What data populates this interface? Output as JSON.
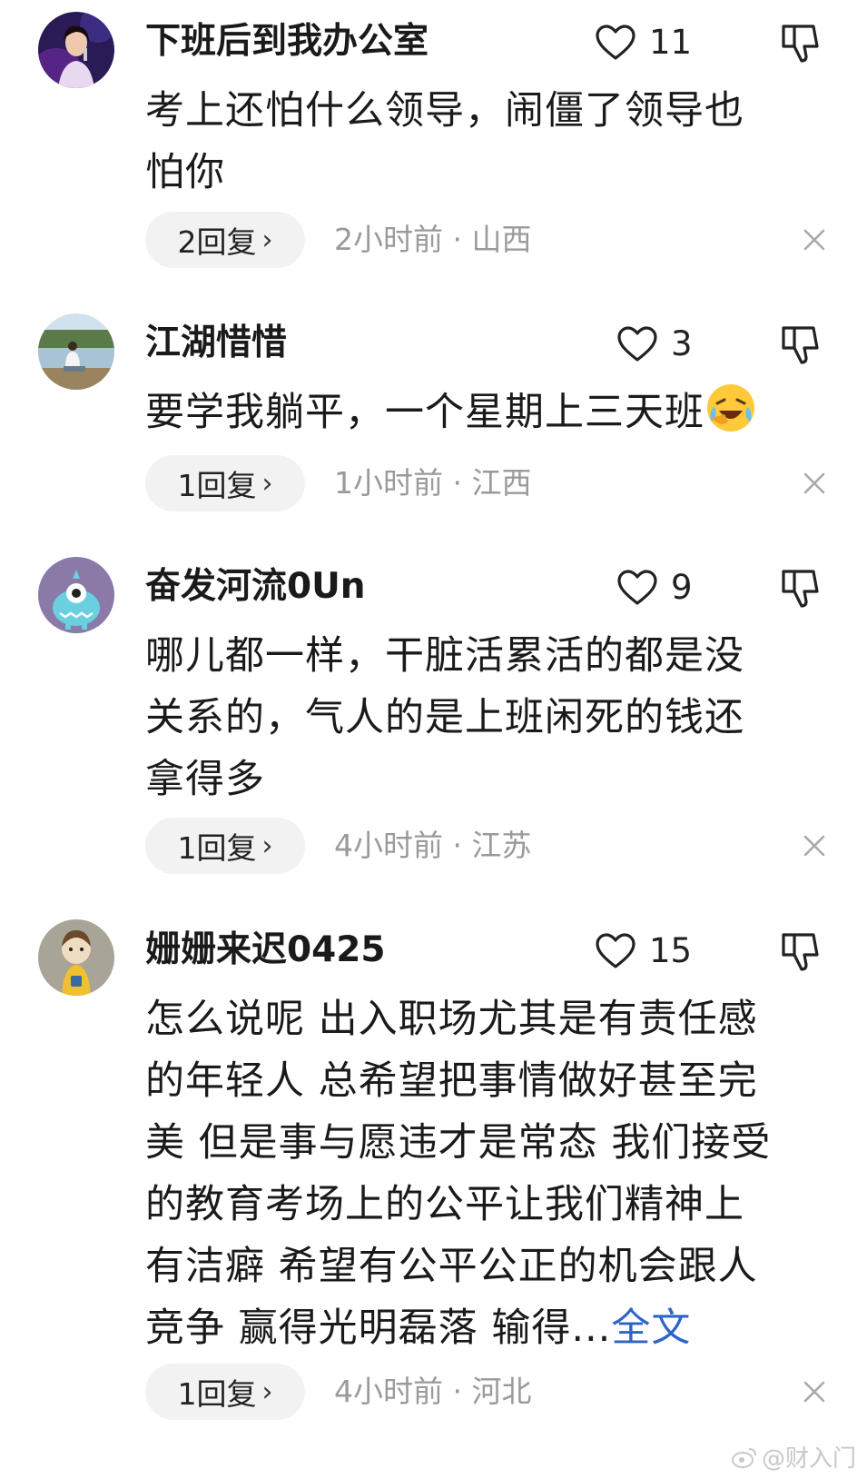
{
  "comments": [
    {
      "username": "下班后到我办公室",
      "likes": "11",
      "lines": [
        "考上还怕什么领导，闹僵了领导也",
        "怕你"
      ],
      "reply_count": "2回复",
      "meta": "2小时前 · 山西",
      "avatar_icon": "avatar-singer-photo"
    },
    {
      "username": "江湖惜惜",
      "likes": "3",
      "lines": [
        "要学我躺平，一个星期上三天班"
      ],
      "reply_count": "1回复",
      "meta": "1小时前 · 江西",
      "avatar_icon": "avatar-lake-photo",
      "emoji": "laughing-crying-emoji"
    },
    {
      "username": "奋发河流0Un",
      "likes": "9",
      "lines": [
        "哪儿都一样，干脏活累活的都是没",
        "关系的，气人的是上班闲死的钱还",
        "拿得多"
      ],
      "reply_count": "1回复",
      "meta": "4小时前 · 江苏",
      "avatar_icon": "avatar-monster-cartoon"
    },
    {
      "username": "姗姗来迟0425",
      "likes": "15",
      "lines": [
        "怎么说呢 出入职场尤其是有责任感",
        "的年轻人 总希望把事情做好甚至完",
        "美 但是事与愿违才是常态 我们接受",
        "的教育考场上的公平让我们精神上",
        "有洁癖 希望有公平公正的机会跟人",
        "竞争 赢得光明磊落 输得..."
      ],
      "more_label": "全文",
      "reply_count": "1回复",
      "meta": "4小时前 · 河北",
      "avatar_icon": "avatar-girl-cartoon"
    }
  ],
  "watermark": "@财入门",
  "colors": {
    "link": "#2d64c8",
    "meta": "#9a9a9a",
    "reply_bg": "#f2f2f2"
  }
}
